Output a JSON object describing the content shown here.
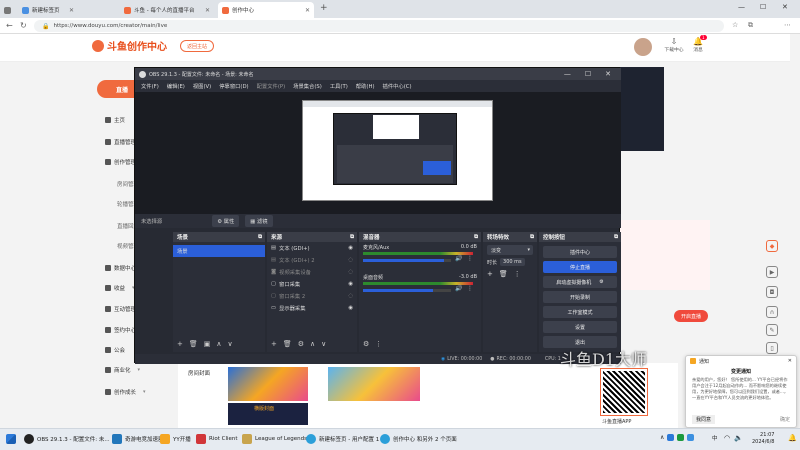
{
  "browser": {
    "tabs": [
      {
        "label": "新建标签页"
      },
      {
        "label": "斗鱼 - 每个人的直播平台"
      },
      {
        "label": "创作中心"
      }
    ],
    "url": "https://www.douyu.com/creator/main/live",
    "new_tab": "+",
    "download_label": "下载中心",
    "message_label": "消息",
    "message_badge": "1"
  },
  "douyu": {
    "logo": "斗鱼创作中心",
    "return_btn": "返回主站",
    "live_btn": "直播",
    "sidebar": [
      {
        "label": "主页"
      },
      {
        "label": "直播管理"
      },
      {
        "label": "创作管理"
      },
      {
        "label": "房间管理",
        "sub": true
      },
      {
        "label": "轮播管理",
        "sub": true
      },
      {
        "label": "直播回放",
        "sub": true
      },
      {
        "label": "视频管理",
        "sub": true
      },
      {
        "label": "数据中心"
      },
      {
        "label": "收益"
      },
      {
        "label": "互动管理"
      },
      {
        "label": "签约中心"
      },
      {
        "label": "公会"
      },
      {
        "label": "商业化"
      },
      {
        "label": "创作成长"
      }
    ],
    "room_cover_label": "房间封面",
    "cover_badge": "横版封面",
    "open_live_btn": "开启直播",
    "qr_label": "斗鱼直播APP",
    "watermark": "斗鱼D1大师"
  },
  "obs": {
    "title": "OBS 29.1.3 - 配置文件: 未命名 - 场景: 未命名",
    "menu": [
      "文件(F)",
      "编辑(E)",
      "视图(V)",
      "停靠窗口(D)",
      "配置文件(P)",
      "场景集合(S)",
      "工具(T)",
      "帮助(H)",
      "插件中心(C)"
    ],
    "no_source": "未选择源",
    "props_btn": "属性",
    "filters_btn": "滤镜",
    "scenes_header": "场景",
    "scenes": [
      "场景"
    ],
    "sources_header": "来源",
    "sources": [
      "文本 (GDI+)",
      "文本 (GDI+) 2",
      "视频采集设备",
      "窗口采集",
      "窗口采集 2",
      "显示器采集"
    ],
    "mixer_header": "混音器",
    "mixer": [
      {
        "name": "麦克风/Aux",
        "db": "0.0 dB",
        "level": 0.92
      },
      {
        "name": "桌面音频",
        "db": "-3.0 dB",
        "level": 0.8
      }
    ],
    "transitions_header": "转场特效",
    "transition": "淡变",
    "duration_label": "时长",
    "duration": "300 ms",
    "controls_header": "控制按钮",
    "controls": [
      "插件中心",
      "停止直播",
      "启动虚拟摄像机",
      "开始录制",
      "工作室模式",
      "设置",
      "退出"
    ],
    "status_live": "LIVE: 00:00:00",
    "status_rec": "REC: 00:00:00",
    "status_cpu": "CPU: 1"
  },
  "notification": {
    "app": "通知",
    "title": "变更通知",
    "body": "亲爱的用户，您好！ 您所使用的... YY平台已经将作用户会注于12月起自动作的... 而不影响您的继续使用，为更好地保障，您可以回到我们设置，或者...，一直在YY平台和YY人员交流的更好地体验。",
    "action1": "我同意",
    "action2": "确定"
  },
  "taskbar": {
    "items": [
      "OBS 29.1.3 - 配置文件: 未...",
      "奇游电竞加速器",
      "YY开播",
      "Riot Client",
      "League of Legends",
      "新建标签页 - 用户配置 1",
      "创作中心 和另外 2 个页面"
    ],
    "ime": "中",
    "time": "21:07",
    "date": "2024/6/8"
  },
  "colors": {
    "douyu_orange": "#f06a3e",
    "obs_bg": "#272a33",
    "obs_blue": "#2b5fd9"
  }
}
